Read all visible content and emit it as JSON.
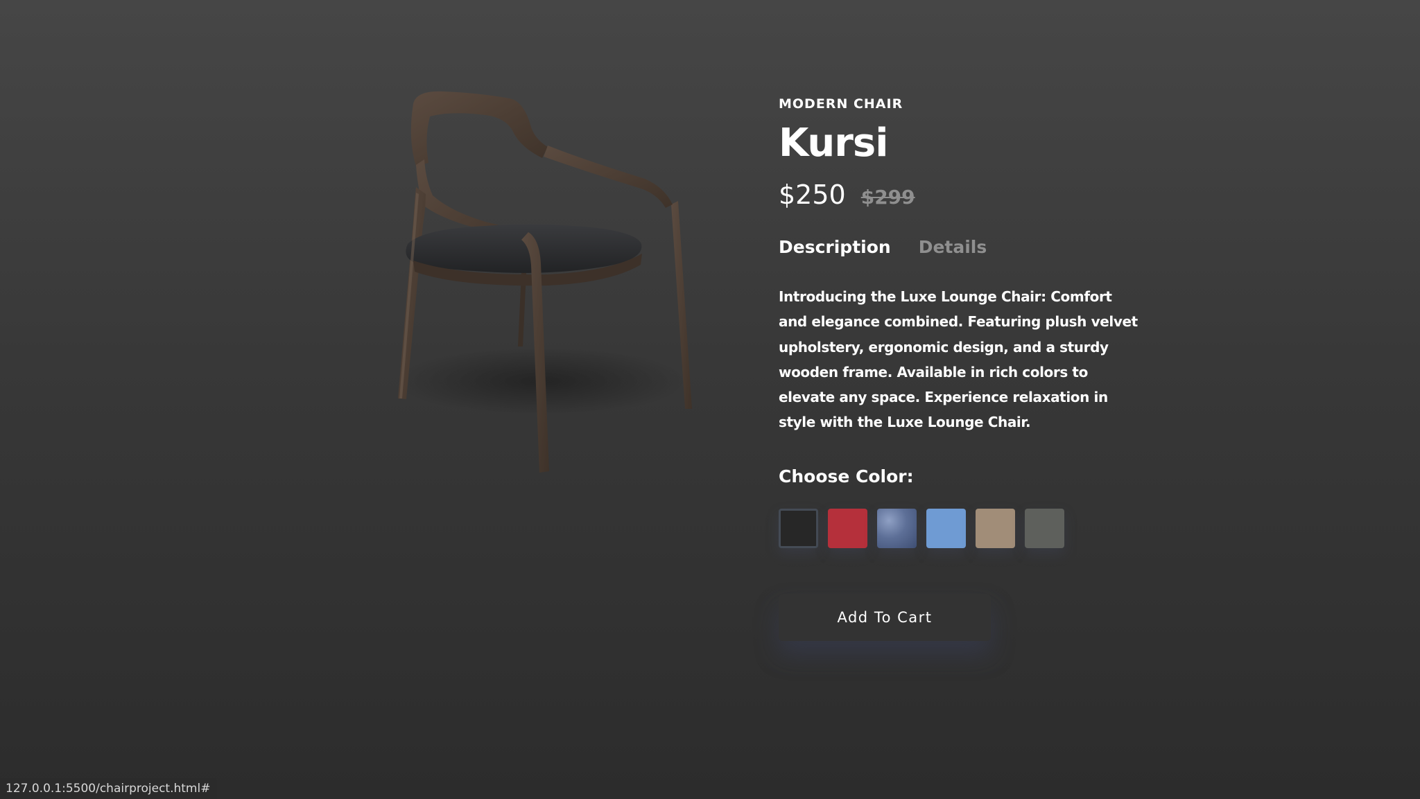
{
  "product": {
    "category": "MODERN CHAIR",
    "name": "Kursi",
    "price_current": "$250",
    "price_old": "$299",
    "image_alt": "chair-image"
  },
  "tabs": [
    {
      "label": "Description",
      "active": true
    },
    {
      "label": "Details",
      "active": false
    }
  ],
  "description": "Introducing the Luxe Lounge Chair: Comfort and elegance combined. Featuring plush velvet upholstery, ergonomic design, and a sturdy wooden frame. Available in rich colors to elevate any space. Experience relaxation in style with the Luxe Lounge Chair.",
  "color_picker": {
    "label": "Choose Color:",
    "swatches": [
      {
        "color": "#272727",
        "selected": true
      },
      {
        "color": "#b5303b",
        "selected": false
      },
      {
        "color": "#5d6f97",
        "selected": false
      },
      {
        "color": "#6f9bd3",
        "selected": false
      },
      {
        "color": "#a18d78",
        "selected": false
      },
      {
        "color": "#5e605c",
        "selected": false
      }
    ]
  },
  "cart": {
    "label": "Add To Cart"
  },
  "status_bar": {
    "url": "127.0.0.1:5500/chairproject.html#"
  },
  "colors": {
    "accent_text": "#ffffff",
    "muted_text": "#8f8f8f",
    "chair_wood": "#4f4036",
    "chair_seat": "#2e2f31"
  }
}
